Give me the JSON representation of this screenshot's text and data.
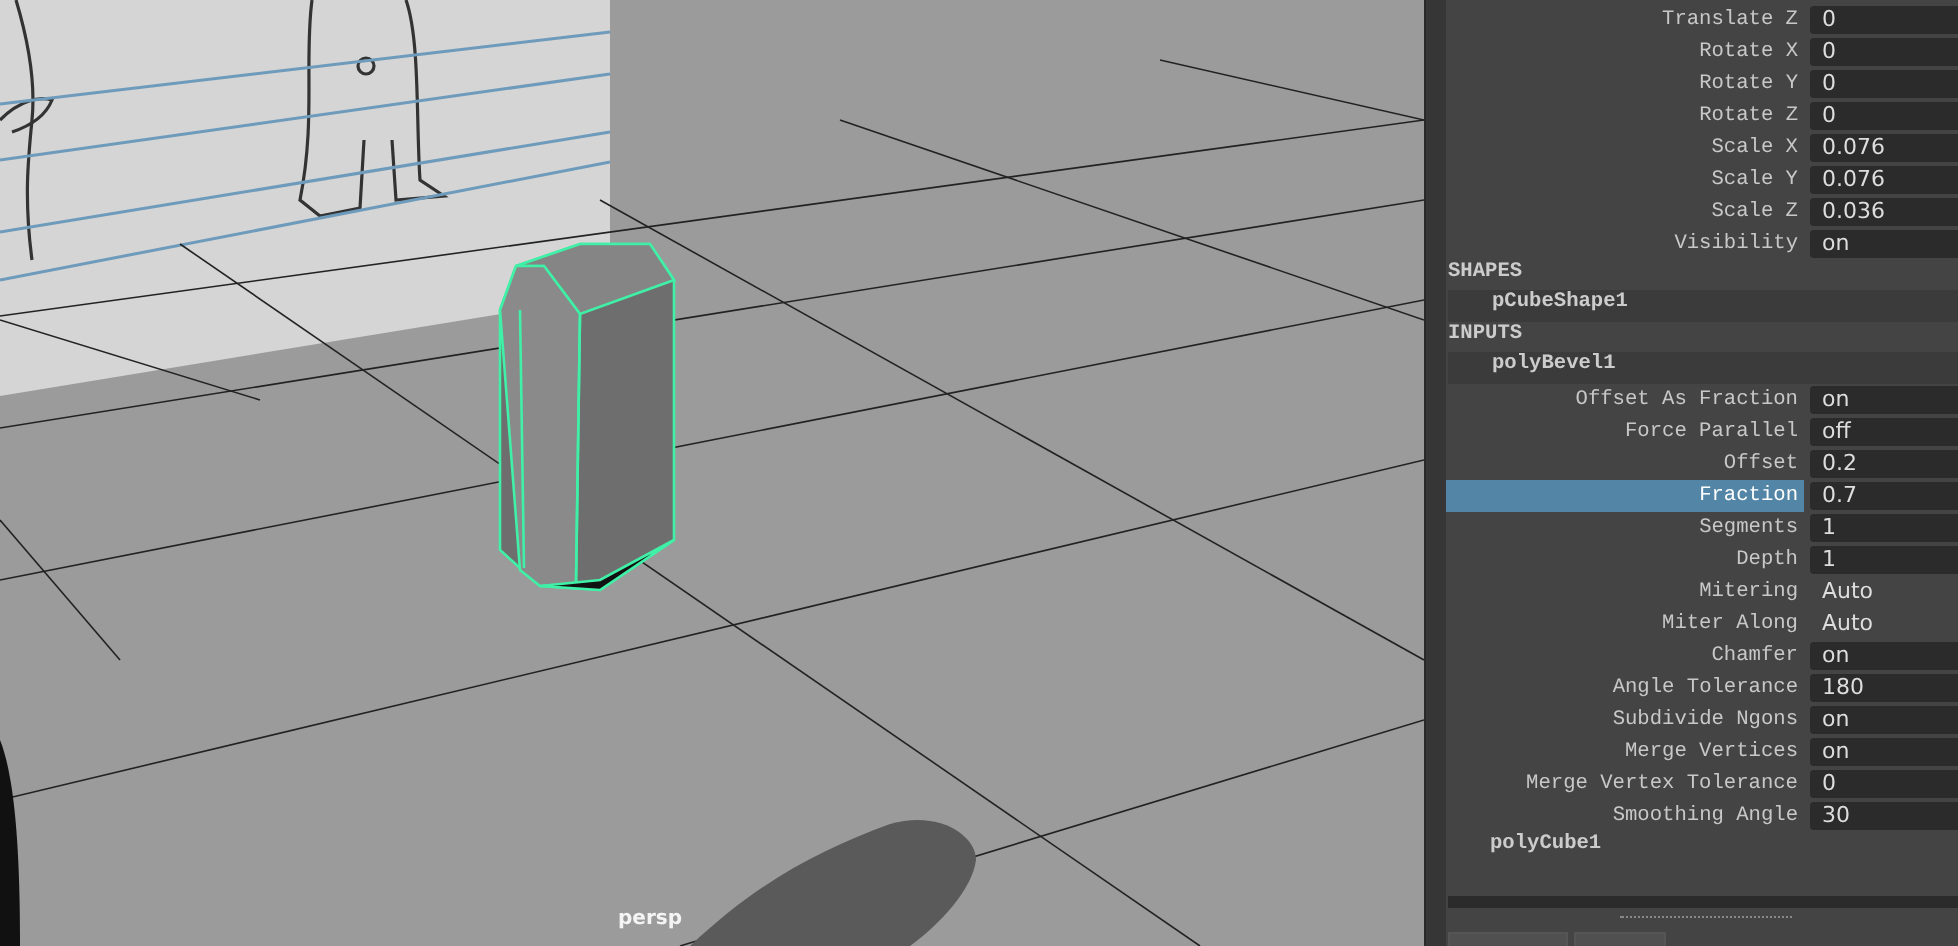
{
  "viewport": {
    "camera_label": "persp"
  },
  "channel_box": {
    "transform_attributes": [
      {
        "label": "Translate Z",
        "value": "0",
        "kind": "field",
        "selected": false
      },
      {
        "label": "Rotate X",
        "value": "0",
        "kind": "field",
        "selected": false
      },
      {
        "label": "Rotate Y",
        "value": "0",
        "kind": "field",
        "selected": false
      },
      {
        "label": "Rotate Z",
        "value": "0",
        "kind": "field",
        "selected": false
      },
      {
        "label": "Scale X",
        "value": "0.076",
        "kind": "field",
        "selected": false
      },
      {
        "label": "Scale Y",
        "value": "0.076",
        "kind": "field",
        "selected": false
      },
      {
        "label": "Scale Z",
        "value": "0.036",
        "kind": "field",
        "selected": false
      },
      {
        "label": "Visibility",
        "value": "on",
        "kind": "field",
        "selected": false
      }
    ],
    "shapes": {
      "header": "SHAPES",
      "nodes": [
        {
          "name": "pCubeShape1"
        }
      ]
    },
    "inputs": {
      "header": "INPUTS",
      "nodes": [
        {
          "name": "polyBevel1",
          "expanded": true,
          "attributes": [
            {
              "label": "Offset As Fraction",
              "value": "on",
              "kind": "field",
              "selected": false
            },
            {
              "label": "Force Parallel",
              "value": "off",
              "kind": "field",
              "selected": false
            },
            {
              "label": "Offset",
              "value": "0.2",
              "kind": "field",
              "selected": false
            },
            {
              "label": "Fraction",
              "value": "0.7",
              "kind": "field",
              "selected": true
            },
            {
              "label": "Segments",
              "value": "1",
              "kind": "field",
              "selected": false
            },
            {
              "label": "Depth",
              "value": "1",
              "kind": "field",
              "selected": false
            },
            {
              "label": "Mitering",
              "value": "Auto",
              "kind": "enum",
              "selected": false
            },
            {
              "label": "Miter Along",
              "value": "Auto",
              "kind": "enum",
              "selected": false
            },
            {
              "label": "Chamfer",
              "value": "on",
              "kind": "field",
              "selected": false
            },
            {
              "label": "Angle Tolerance",
              "value": "180",
              "kind": "field",
              "selected": false
            },
            {
              "label": "Subdivide Ngons",
              "value": "on",
              "kind": "field",
              "selected": false
            },
            {
              "label": "Merge Vertices",
              "value": "on",
              "kind": "field",
              "selected": false
            },
            {
              "label": "Merge Vertex Tolerance",
              "value": "0",
              "kind": "field",
              "selected": false
            },
            {
              "label": "Smoothing Angle",
              "value": "30",
              "kind": "field",
              "selected": false
            }
          ]
        },
        {
          "name": "polyCube1",
          "expanded": false
        }
      ]
    }
  }
}
